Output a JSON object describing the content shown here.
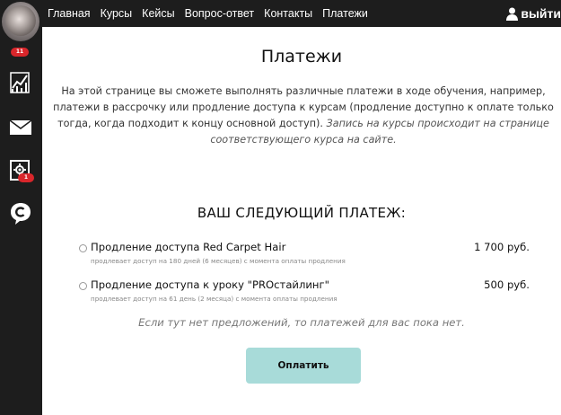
{
  "nav": {
    "items": [
      "Главная",
      "Курсы",
      "Кейсы",
      "Вопрос-ответ",
      "Контакты",
      "Платежи"
    ],
    "logout_label": "выйти"
  },
  "sidebar": {
    "avatar_badge": "11",
    "settings_badge": "1"
  },
  "page": {
    "title": "Платежи",
    "intro_text": "На этой странице вы сможете выполнять различные платежи в ходе обучения, например, платежи в рассрочку или продление доступа к курсам (продление доступно к оплате только тогда, когда подходит к концу основной доступ).",
    "intro_italic": "Запись на курсы происходит на странице соответствующего курса на сайте.",
    "next_payment_heading": "ВАШ СЛЕДУЮЩИЙ ПЛАТЕЖ:",
    "payments": [
      {
        "name": "Продление доступа Red Carpet Hair",
        "price": "1 700 руб.",
        "description": "продлевает доступ на 180 дней (6 месяцев) с момента оплаты продления"
      },
      {
        "name": "Продление доступа к уроку \"PROстайлинг\"",
        "price": "500 руб.",
        "description": "продлевает доступ на 61 день (2 месяца) с момента оплаты продления"
      }
    ],
    "no_offers_text": "Если тут нет предложений, то платежей для вас пока нет.",
    "pay_button_label": "Оплатить"
  },
  "colors": {
    "sidebar_bg": "#1d1d1d",
    "badge": "#d9262b",
    "pay_button": "#a8dbd9"
  }
}
